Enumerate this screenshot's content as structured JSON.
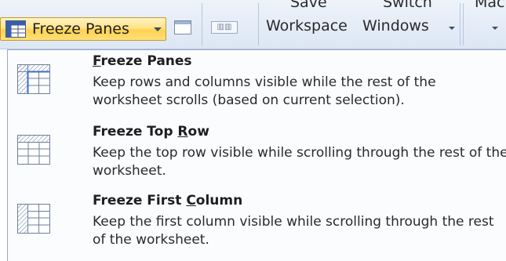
{
  "ribbon": {
    "freeze_button_label": "Freeze Panes",
    "save_workspace_top": "Save",
    "save_workspace_bottom": "Workspace",
    "switch_windows_top": "Switch",
    "switch_windows_bottom": "Windows",
    "macros_partial": "Mac"
  },
  "menu": {
    "items": [
      {
        "title_accel": "F",
        "title_rest": "reeze Panes",
        "description": "Keep rows and columns visible while the rest of the worksheet scrolls (based on current selection).",
        "icon": "freeze-panes-icon"
      },
      {
        "title_pre": "Freeze Top ",
        "title_accel": "R",
        "title_post": "ow",
        "description": "Keep the top row visible while scrolling through the rest of the worksheet.",
        "icon": "freeze-top-row-icon"
      },
      {
        "title_pre": "Freeze First ",
        "title_accel": "C",
        "title_post": "olumn",
        "description": "Keep the first column visible while scrolling through the rest of the worksheet.",
        "icon": "freeze-first-column-icon"
      }
    ]
  },
  "colors": {
    "button_highlight": "#ffd24f",
    "ribbon_bg": "#e4ecf7",
    "menu_bg": "#fbfcfe"
  }
}
